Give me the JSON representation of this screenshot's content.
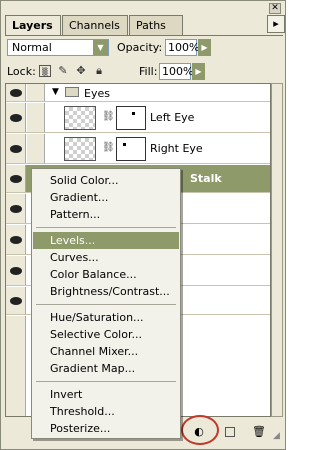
{
  "tabs": [
    {
      "label": "Layers",
      "active": true
    },
    {
      "label": "Channels",
      "active": false
    },
    {
      "label": "Paths",
      "active": false
    }
  ],
  "blend": {
    "mode": "Normal",
    "opacity_label": "Opacity:",
    "opacity_value": "100%"
  },
  "lock": {
    "label": "Lock:",
    "fill_label": "Fill:",
    "fill_value": "100%"
  },
  "layers": {
    "group_name": "Eyes",
    "left_eye": "Left Eye",
    "right_eye": "Right Eye",
    "stalk_partial": "Stalk"
  },
  "menu": {
    "items": [
      {
        "label": "Solid Color..."
      },
      {
        "label": "Gradient..."
      },
      {
        "label": "Pattern..."
      },
      {
        "label": "Levels...",
        "highlighted": true
      },
      {
        "label": "Curves..."
      },
      {
        "label": "Color Balance..."
      },
      {
        "label": "Brightness/Contrast..."
      },
      {
        "label": "Hue/Saturation..."
      },
      {
        "label": "Selective Color..."
      },
      {
        "label": "Channel Mixer..."
      },
      {
        "label": "Gradient Map..."
      },
      {
        "label": "Invert"
      },
      {
        "label": "Threshold..."
      },
      {
        "label": "Posterize..."
      }
    ]
  },
  "icons": {
    "visibility": "eye-icon",
    "folder": "folder-icon",
    "link": "chain-link-icon",
    "adjustment": "adjustment-layer-icon",
    "new_layer": "new-layer-icon",
    "trash": "trash-icon"
  },
  "colors": {
    "highlight": "#8f9a6a",
    "callout_circle": "#c0392b"
  }
}
